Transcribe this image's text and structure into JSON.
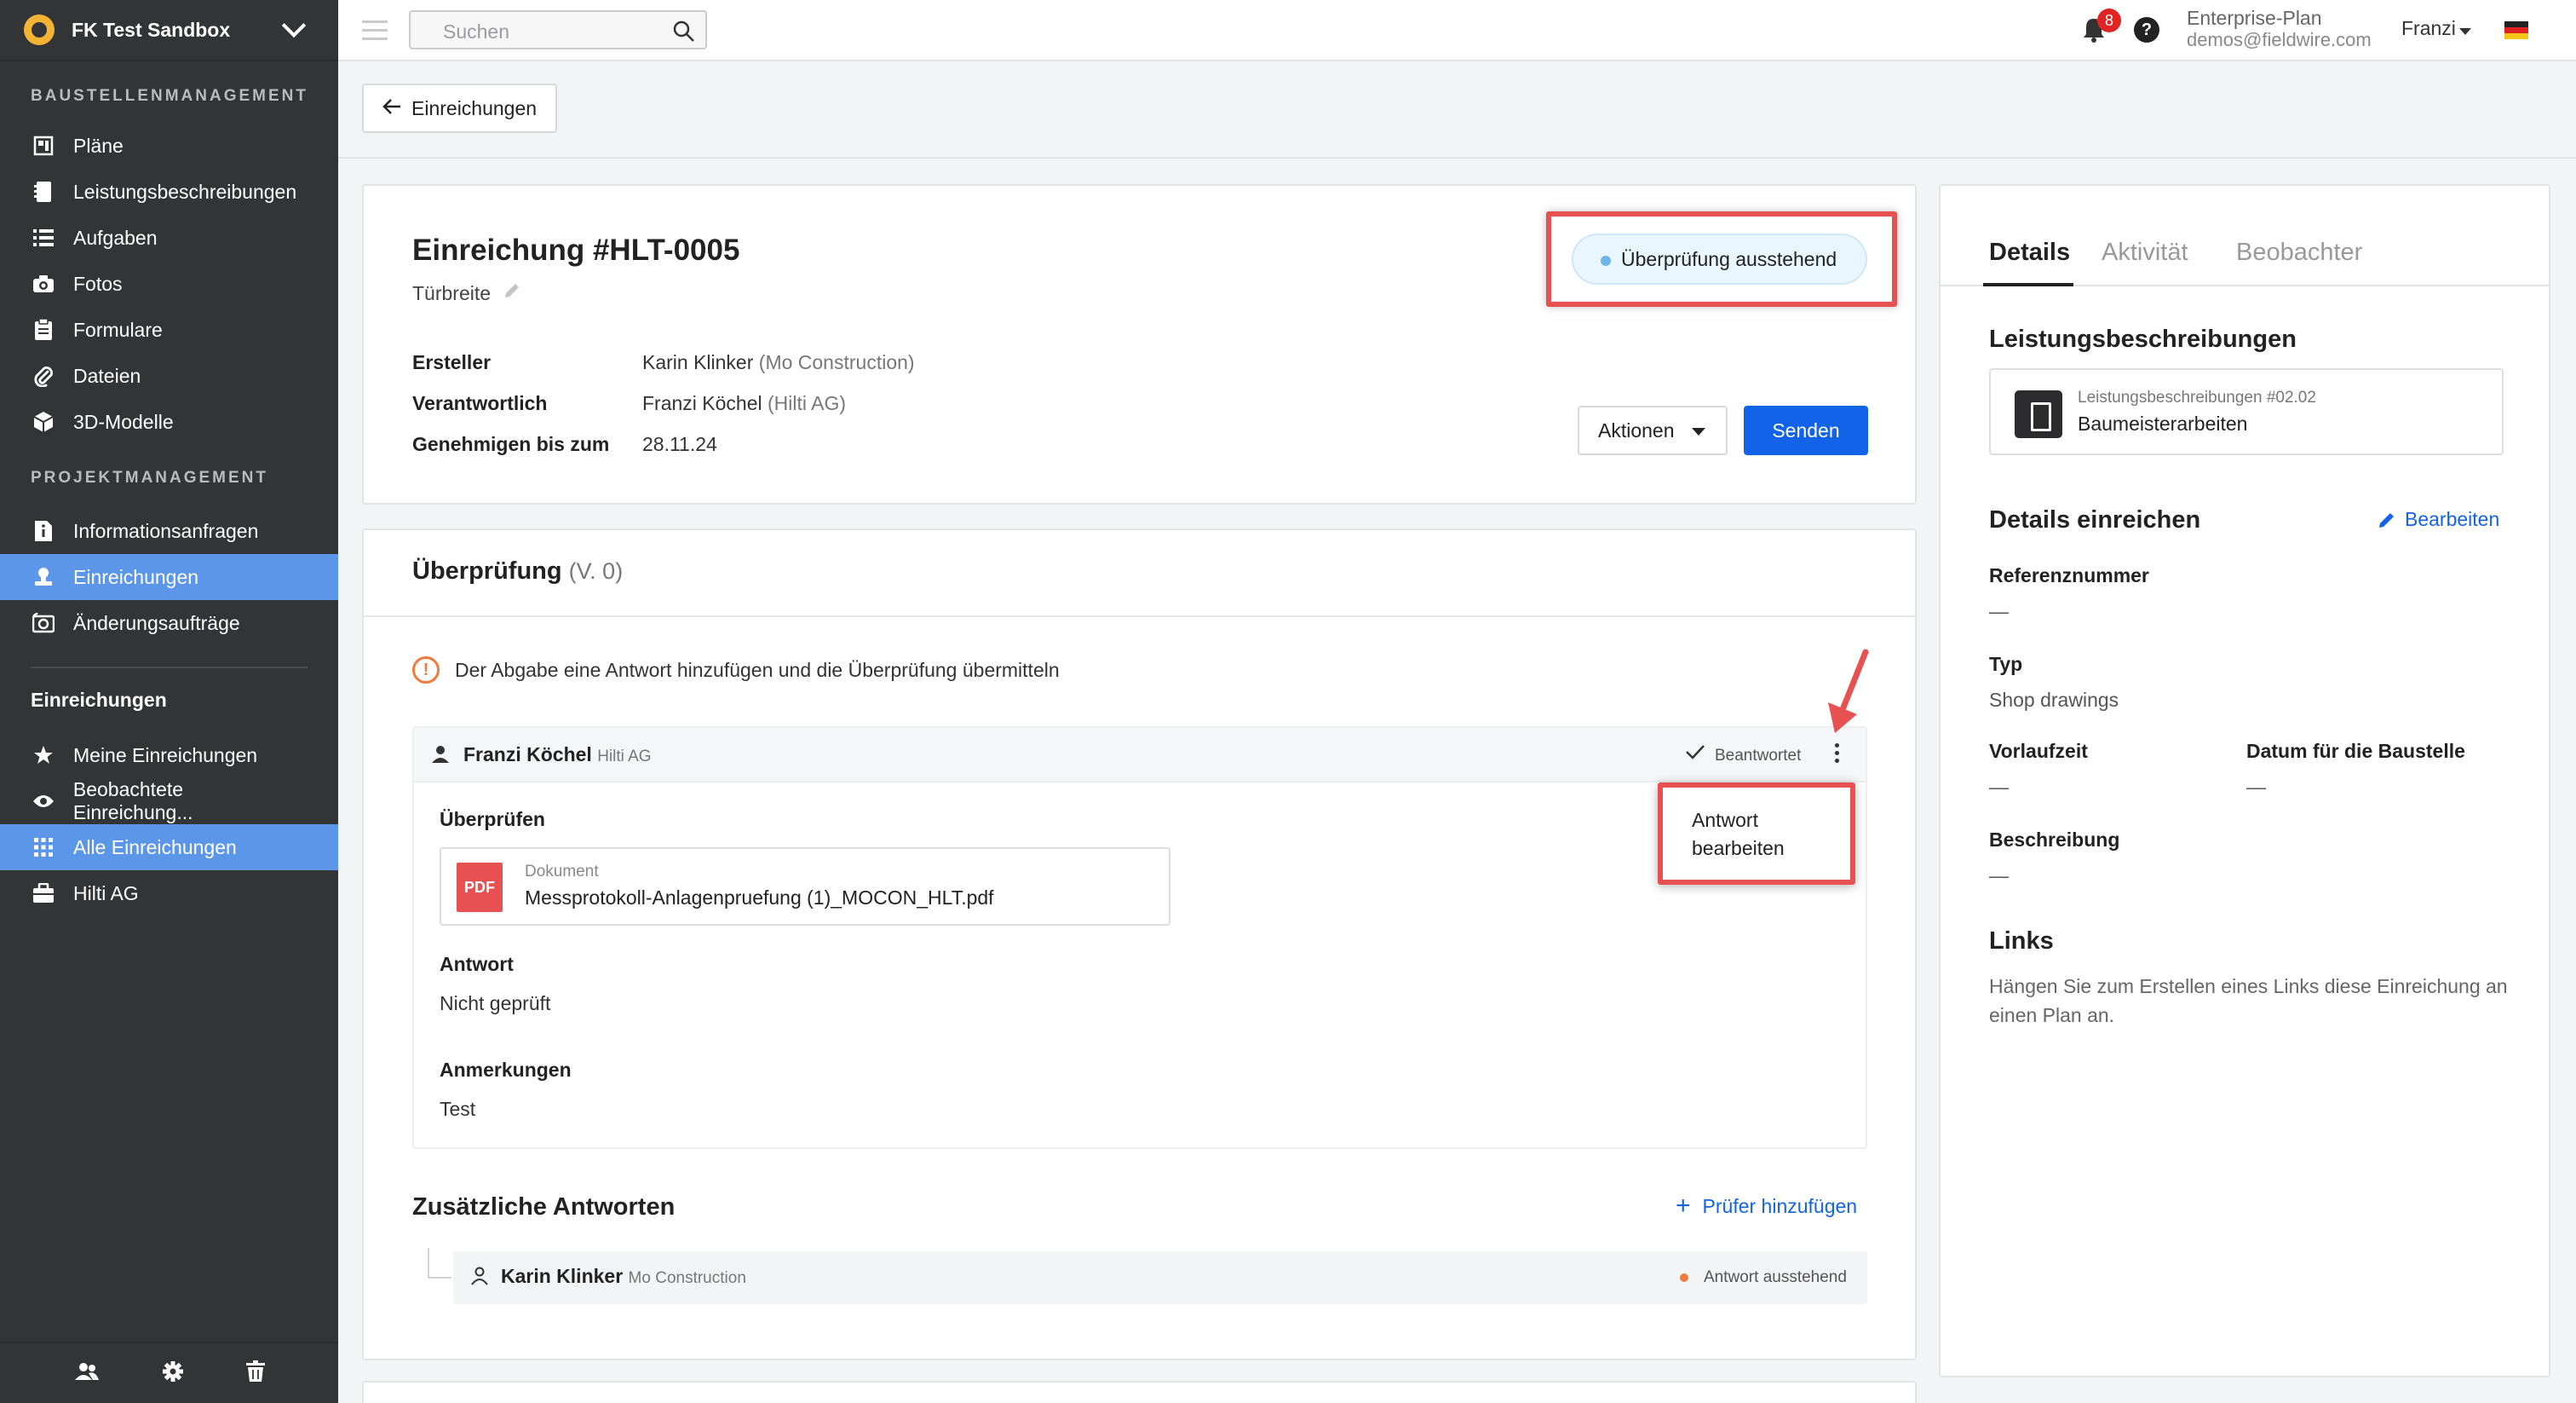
{
  "sidebar": {
    "project_name": "FK Test Sandbox",
    "section_site": "BAUSTELLENMANAGEMENT",
    "section_project": "PROJEKTMANAGEMENT",
    "site_items": [
      {
        "label": "Pläne",
        "icon": "plans-icon"
      },
      {
        "label": "Leistungsbeschreibungen",
        "icon": "specs-icon"
      },
      {
        "label": "Aufgaben",
        "icon": "tasks-icon"
      },
      {
        "label": "Fotos",
        "icon": "camera-icon"
      },
      {
        "label": "Formulare",
        "icon": "forms-icon"
      },
      {
        "label": "Dateien",
        "icon": "paperclip-icon"
      },
      {
        "label": "3D-Modelle",
        "icon": "cube-icon"
      }
    ],
    "project_items": [
      {
        "label": "Informationsanfragen",
        "icon": "info-doc-icon"
      },
      {
        "label": "Einreichungen",
        "icon": "submittal-icon",
        "active": true
      },
      {
        "label": "Änderungsaufträge",
        "icon": "change-order-icon"
      }
    ],
    "submittals_heading": "Einreichungen",
    "submittal_items": [
      {
        "label": "Meine Einreichungen",
        "icon": "star-icon"
      },
      {
        "label": "Beobachtete Einreichung...",
        "icon": "eye-icon"
      },
      {
        "label": "Alle Einreichungen",
        "icon": "grid-icon",
        "active": true
      },
      {
        "label": "Hilti AG",
        "icon": "briefcase-icon"
      }
    ]
  },
  "topbar": {
    "search_placeholder": "Suchen",
    "notification_count": "8",
    "help_label": "?",
    "plan_name": "Enterprise-Plan",
    "account_email": "demos@fieldwire.com",
    "user_name": "Franzi"
  },
  "back_button": "Einreichungen",
  "submittal": {
    "title": "Einreichung #HLT-0005",
    "subtitle": "Türbreite",
    "status": "Überprüfung ausstehend",
    "meta": [
      {
        "key": "Ersteller",
        "name": "Karin Klinker",
        "org": "(Mo Construction)"
      },
      {
        "key": "Verantwortlich",
        "name": "Franzi Köchel",
        "org": "(Hilti AG)"
      },
      {
        "key": "Genehmigen bis zum",
        "name": "28.11.24",
        "org": ""
      }
    ],
    "actions_label": "Aktionen",
    "send_label": "Senden"
  },
  "review": {
    "title": "Überprüfung",
    "version": "(V. 0)",
    "notice": "Der Abgabe eine Antwort hinzufügen und die Überprüfung übermitteln",
    "reviewer_name": "Franzi Köchel",
    "reviewer_org": "Hilti AG",
    "reviewer_status": "Beantwortet",
    "review_label": "Überprüfen",
    "document_type": "Dokument",
    "document_name": "Messprotokoll-Anlagenpruefung (1)_MOCON_HLT.pdf",
    "pdf_badge": "PDF",
    "response_label": "Antwort",
    "response_value": "Nicht geprüft",
    "notes_label": "Anmerkungen",
    "notes_value": "Test",
    "menu_item": "Antwort bearbeiten"
  },
  "additional": {
    "title": "Zusätzliche Antworten",
    "add_reviewer": "Prüfer hinzufügen",
    "reviewer_name": "Karin Klinker",
    "reviewer_org": "Mo Construction",
    "reviewer_status": "Antwort ausstehend"
  },
  "right_panel": {
    "tabs": [
      "Details",
      "Aktivität",
      "Beobachter"
    ],
    "specs_heading": "Leistungsbeschreibungen",
    "spec_ref": "Leistungsbeschreibungen #02.02",
    "spec_name": "Baumeisterarbeiten",
    "details_heading": "Details einreichen",
    "edit_label": "Bearbeiten",
    "ref_label": "Referenznummer",
    "ref_value": "—",
    "type_label": "Typ",
    "type_value": "Shop drawings",
    "lead_label": "Vorlaufzeit",
    "lead_value": "—",
    "site_date_label": "Datum für die Baustelle",
    "site_date_value": "—",
    "desc_label": "Beschreibung",
    "desc_value": "—",
    "links_heading": "Links",
    "links_text": "Hängen Sie zum Erstellen eines Links diese Einreichung an einen Plan an."
  },
  "colors": {
    "sidebar_bg": "#333436",
    "active_nav": "#5b96e8",
    "primary": "#1363e9",
    "highlight": "#e85151"
  }
}
